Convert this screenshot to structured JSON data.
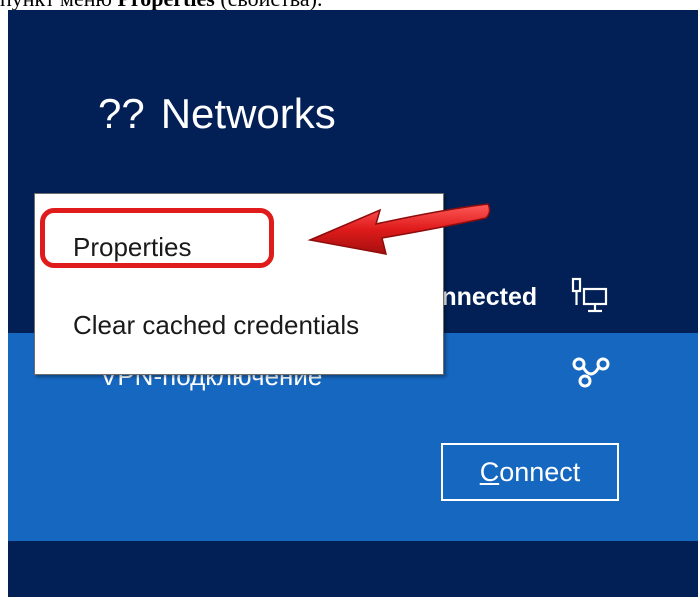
{
  "caption": {
    "before": "пункт меню ",
    "bold": "Properties",
    "after": " (свойства)."
  },
  "header": {
    "icon_glyph": "??",
    "title": "Networks"
  },
  "ethernet": {
    "status": "Connected"
  },
  "vpn": {
    "name": "VPN-подключение",
    "connect_rest": "onnect",
    "connect_first": "C"
  },
  "context_menu": {
    "items": [
      {
        "label": "Properties"
      },
      {
        "label": "Clear cached credentials"
      }
    ]
  },
  "colors": {
    "panel_bg": "#022055",
    "vpn_bg": "#1667bf",
    "highlight": "#e01b1b",
    "arrow": "#e01b1b"
  },
  "icons": {
    "ethernet": "ethernet-icon",
    "vpn": "vpn-icon"
  }
}
